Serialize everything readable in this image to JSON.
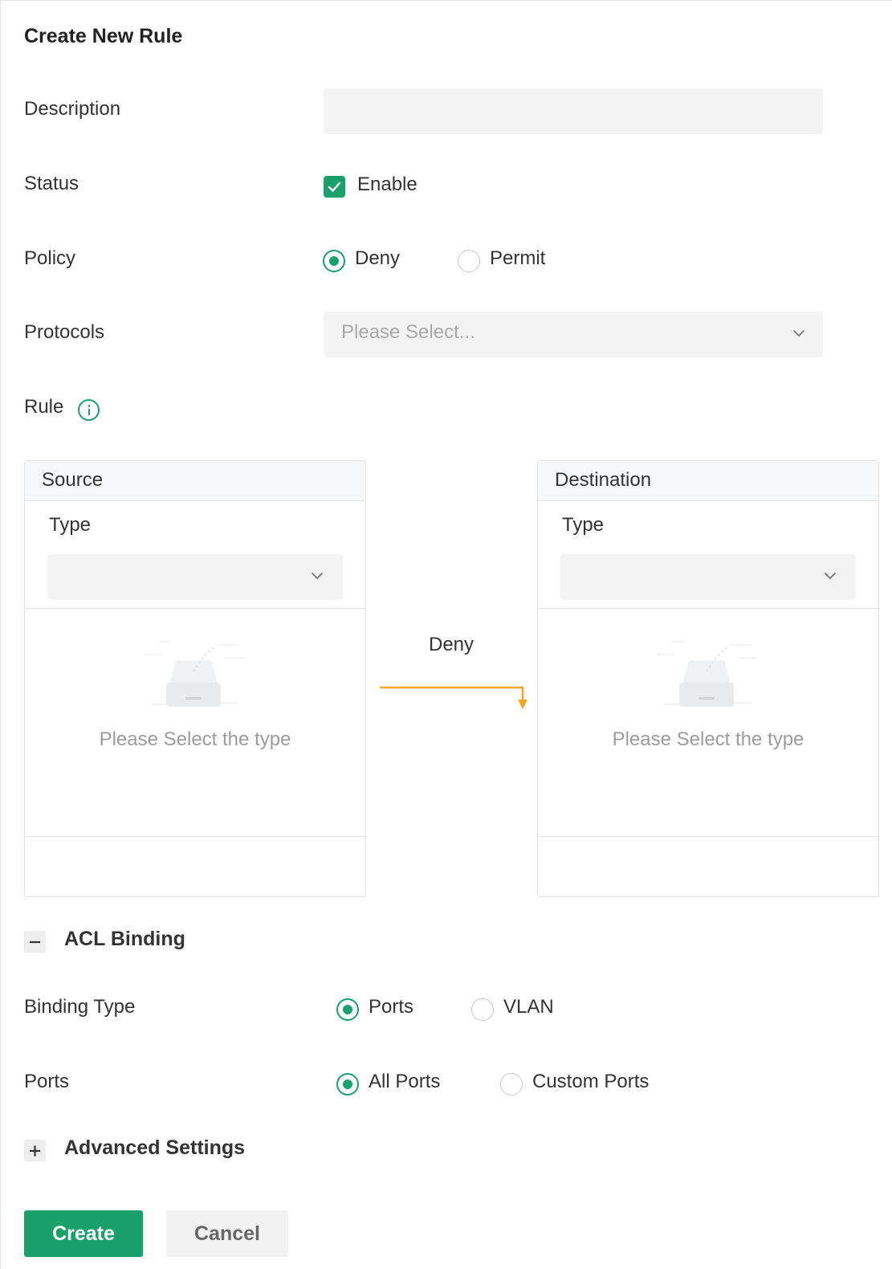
{
  "dialog": {
    "title": "Create New Rule"
  },
  "form": {
    "description": {
      "label": "Description",
      "value": "",
      "placeholder": ""
    },
    "status": {
      "label": "Status",
      "option": "Enable",
      "checked": true
    },
    "policy": {
      "label": "Policy",
      "options": [
        "Deny",
        "Permit"
      ],
      "selected": "Deny"
    },
    "protocols": {
      "label": "Protocols",
      "placeholder": "Please Select..."
    },
    "rule": {
      "label": "Rule",
      "info_icon": "info-icon"
    }
  },
  "rule_editor": {
    "source": {
      "header": "Source",
      "type_label": "Type",
      "empty_text": "Please Select the type"
    },
    "destination": {
      "header": "Destination",
      "type_label": "Type",
      "empty_text": "Please Select the type"
    },
    "action_label": "Deny",
    "arrow_color": "#f5a623"
  },
  "acl_binding": {
    "section_title": "ACL Binding",
    "toggle_icon": "minus-icon",
    "binding_type": {
      "label": "Binding Type",
      "options": [
        "Ports",
        "VLAN"
      ],
      "selected": "Ports"
    },
    "ports": {
      "label": "Ports",
      "options": [
        "All Ports",
        "Custom Ports"
      ],
      "selected": "All Ports"
    }
  },
  "advanced": {
    "section_title": "Advanced Settings",
    "toggle_icon": "plus-icon"
  },
  "actions": {
    "create_label": "Create",
    "cancel_label": "Cancel"
  },
  "theme": {
    "accent": "#1aa16b",
    "input_bg": "#f3f3f3"
  }
}
